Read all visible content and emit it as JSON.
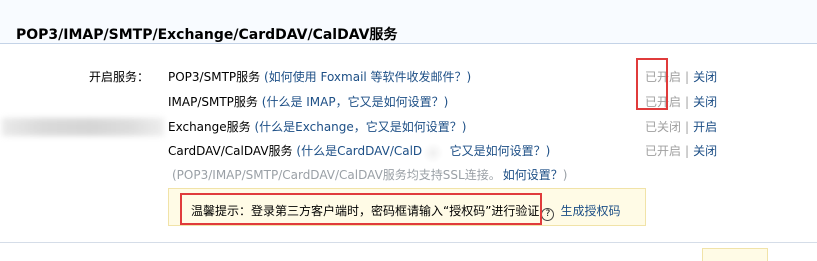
{
  "header": {
    "title": "POP3/IMAP/SMTP/Exchange/CardDAV/CalDAV服务"
  },
  "form": {
    "label": "开启服务："
  },
  "services": [
    {
      "name": "POP3/SMTP服务",
      "help_prefix": "(",
      "help_text": "如何使用 Foxmail 等软件收发邮件？",
      "help_suffix": ")",
      "status": "已开启",
      "separator": "|",
      "action": "关闭"
    },
    {
      "name": "IMAP/SMTP服务",
      "help_prefix": "(",
      "help_text": "什么是 IMAP，它又是如何设置？",
      "help_suffix": ")",
      "status": "已开启",
      "separator": "|",
      "action": "关闭"
    },
    {
      "name": "Exchange服务",
      "help_prefix": "(",
      "help_text": "什么是Exchange，它又是如何设置？",
      "help_suffix": ")",
      "status": "已关闭",
      "separator": "|",
      "action": "开启"
    },
    {
      "name": "CardDAV/CalDAV服务",
      "help_prefix": "(",
      "help_text": "什么是CardDAV/CalDAV，它又是如何设置？",
      "help_suffix": ")",
      "status": "已开启",
      "separator": "|",
      "action": "关闭"
    }
  ],
  "ssl_note": {
    "text": "(POP3/IMAP/SMTP/CardDAV/CalDAV服务均支持SSL连接。",
    "link": "如何设置？",
    "suffix": ")"
  },
  "tip": {
    "text": "温馨提示：登录第三方客户端时，密码框请输入“授权码”进行验证",
    "help_icon": "?",
    "link": "生成授权码"
  },
  "colors": {
    "link": "#1d4f86",
    "muted": "#a0a0a0",
    "highlight_box": "#e03b3b",
    "tip_bg": "#fffbe6",
    "header_bg": "#f8fbff"
  }
}
